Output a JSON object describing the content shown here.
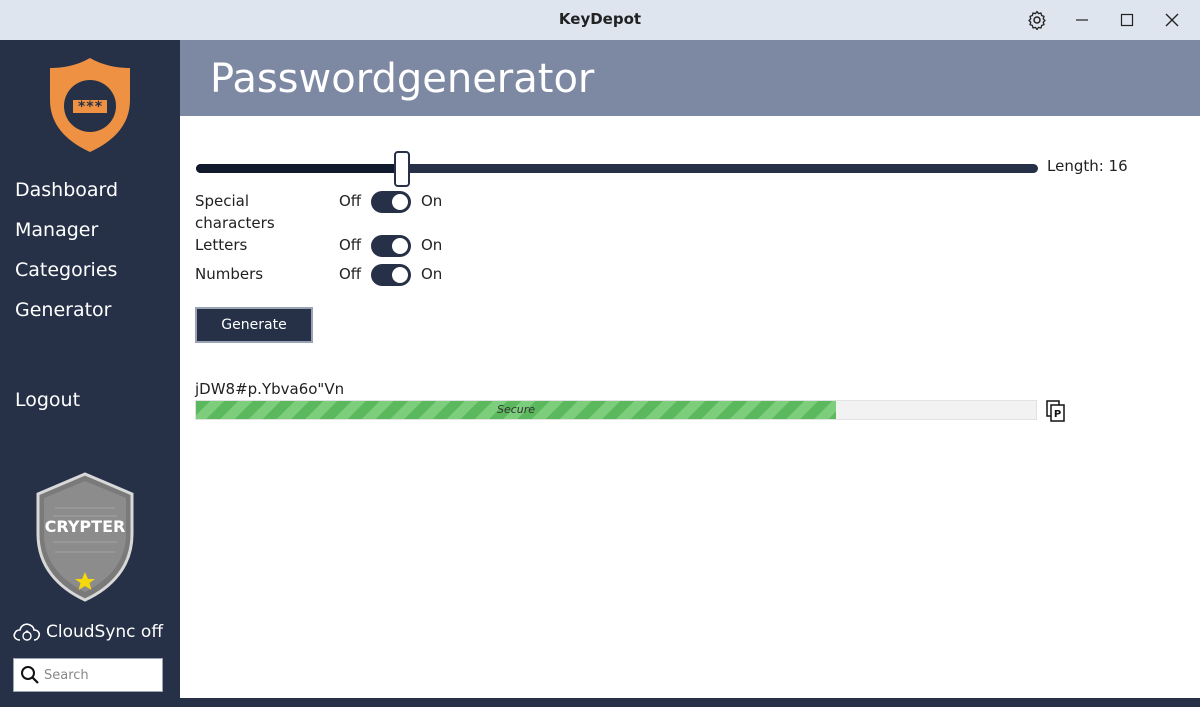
{
  "window": {
    "title": "KeyDepot"
  },
  "sidebar": {
    "items": [
      {
        "label": "Dashboard"
      },
      {
        "label": "Manager"
      },
      {
        "label": "Categories"
      },
      {
        "label": "Generator"
      },
      {
        "label": "Logout"
      }
    ],
    "logo_text": "***",
    "badge_text": "CRYPTER",
    "cloudsync_label": "CloudSync off",
    "search_placeholder": "Search"
  },
  "header": {
    "title": "Passwordgenerator"
  },
  "generator": {
    "length_label": "Length: 16",
    "length_value": 16,
    "length_fraction": 0.245,
    "options": [
      {
        "label": "Special characters",
        "off": "Off",
        "on": "On",
        "state": true
      },
      {
        "label": "Letters",
        "off": "Off",
        "on": "On",
        "state": true
      },
      {
        "label": "Numbers",
        "off": "Off",
        "on": "On",
        "state": true
      }
    ],
    "generate_label": "Generate",
    "password": "jDW8#p.Ybva6o\"Vn",
    "strength_label": "Secure",
    "strength_fraction": 0.762
  },
  "colors": {
    "sidebar": "#263147",
    "header": "#7d88a3",
    "accent_green": "#5cb85c",
    "logo_orange": "#ef9142"
  }
}
